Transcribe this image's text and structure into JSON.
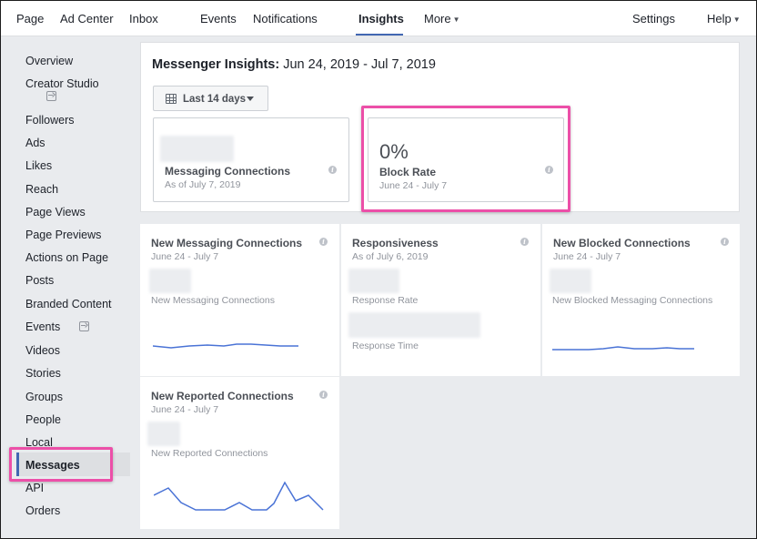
{
  "topnav": {
    "items": [
      {
        "label": "Page"
      },
      {
        "label": "Ad Center"
      },
      {
        "label": "Inbox"
      },
      {
        "label": "Events"
      },
      {
        "label": "Notifications"
      },
      {
        "label": "Insights"
      },
      {
        "label": "More"
      },
      {
        "label": "Settings"
      },
      {
        "label": "Help"
      }
    ],
    "active": "Insights",
    "caret_glyph": "▼"
  },
  "sidebar": {
    "items": [
      {
        "label": "Overview"
      },
      {
        "label": "Creator Studio"
      },
      {
        "label": "Followers"
      },
      {
        "label": "Ads"
      },
      {
        "label": "Likes"
      },
      {
        "label": "Reach"
      },
      {
        "label": "Page Views"
      },
      {
        "label": "Page Previews"
      },
      {
        "label": "Actions on Page"
      },
      {
        "label": "Posts"
      },
      {
        "label": "Branded Content"
      },
      {
        "label": "Events"
      },
      {
        "label": "Videos"
      },
      {
        "label": "Stories"
      },
      {
        "label": "Groups"
      },
      {
        "label": "People"
      },
      {
        "label": "Local"
      },
      {
        "label": "Messages"
      },
      {
        "label": "API"
      },
      {
        "label": "Orders"
      }
    ],
    "active": "Messages"
  },
  "header": {
    "title_prefix": "Messenger Insights:",
    "title_range": "Jun 24, 2019 - Jul 7, 2019",
    "date_button": "Last 14 days",
    "info_glyph": "i"
  },
  "stats": {
    "messaging_connections": {
      "label": "Messaging Connections",
      "sub": "As of July 7, 2019"
    },
    "block_rate": {
      "value": "0%",
      "label": "Block Rate",
      "sub": "June 24 - July 7"
    }
  },
  "metrics": {
    "new_messaging": {
      "title": "New Messaging Connections",
      "sub": "June 24 - July 7",
      "label": "New Messaging Connections"
    },
    "responsiveness": {
      "title": "Responsiveness",
      "sub": "As of July 6, 2019",
      "rate_label": "Response Rate",
      "time_label": "Response Time"
    },
    "new_blocked": {
      "title": "New Blocked Connections",
      "sub": "June 24 - July 7",
      "label": "New Blocked Messaging Connections"
    },
    "new_reported": {
      "title": "New Reported Connections",
      "sub": "June 24 - July 7",
      "label": "New Reported Connections"
    }
  },
  "colors": {
    "accent": "#4267b2",
    "highlight": "#ec4fa8",
    "sparkline": "#4a73d6"
  }
}
